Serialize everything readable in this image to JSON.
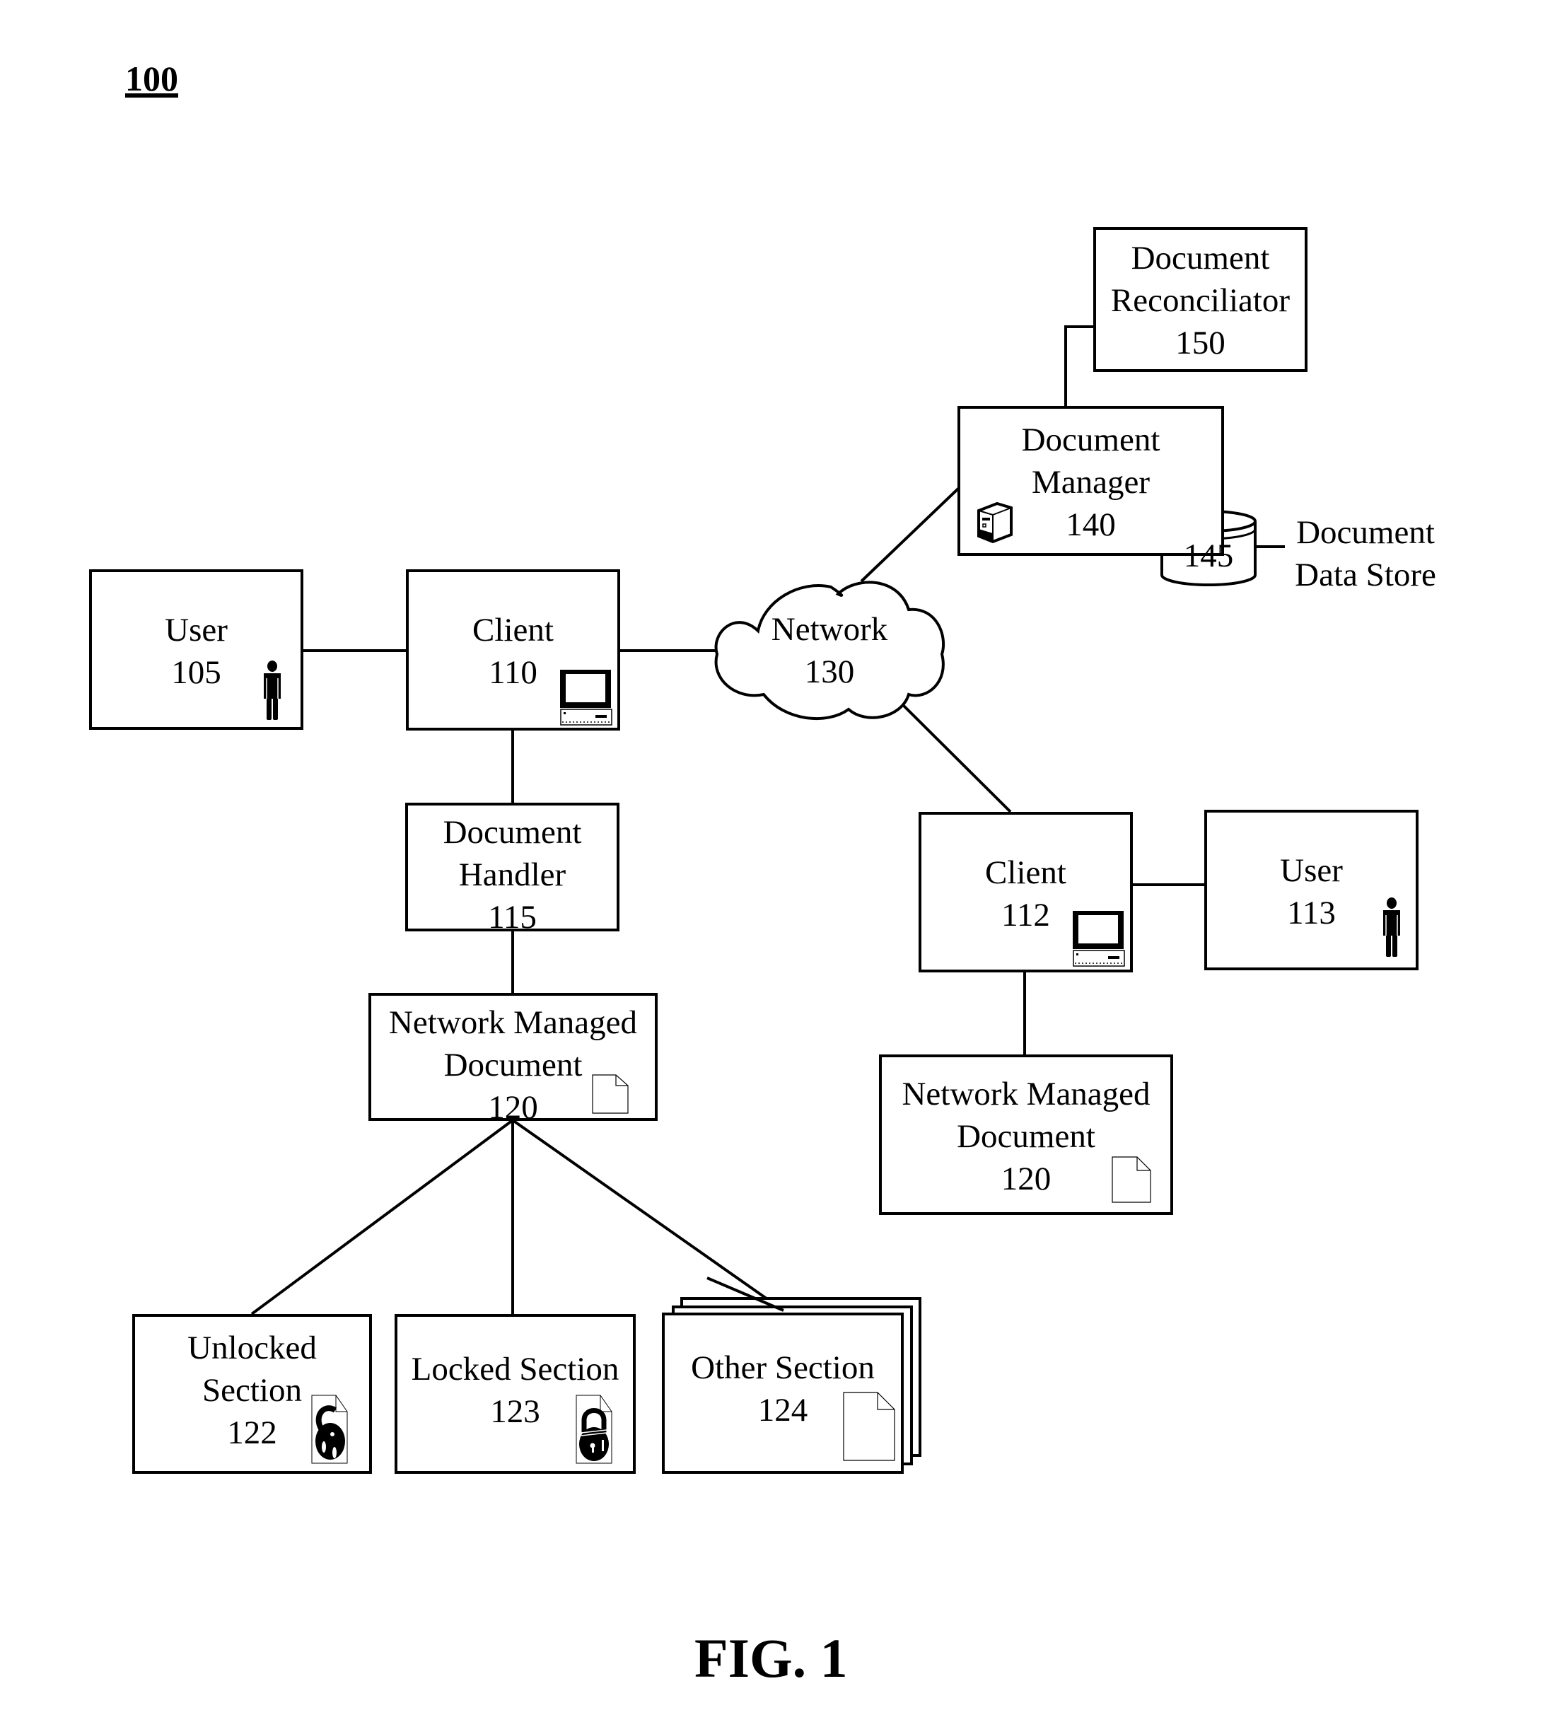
{
  "figure": {
    "reference": "100",
    "caption": "FIG. 1"
  },
  "nodes": {
    "user_105": {
      "lines": [
        "User",
        "105"
      ],
      "icon": "person-icon"
    },
    "client_110": {
      "lines": [
        "Client",
        "110"
      ],
      "icon": "computer-icon"
    },
    "network_130": {
      "lines": [
        "Network",
        "130"
      ],
      "shape": "cloud"
    },
    "document_manager_140": {
      "lines": [
        "Document",
        "Manager",
        "140"
      ],
      "icon": "server-icon"
    },
    "document_data_store_145": {
      "number": "145",
      "caption_lines": [
        "Document",
        "Data Store"
      ],
      "shape": "cylinder"
    },
    "document_reconciliator_150": {
      "lines": [
        "Document",
        "Reconciliator",
        "150"
      ]
    },
    "document_handler_115": {
      "lines": [
        "Document",
        "Handler",
        "115"
      ]
    },
    "network_managed_document_left": {
      "lines": [
        "Network Managed",
        "Document",
        "120"
      ],
      "icon": "document-icon"
    },
    "client_112": {
      "lines": [
        "Client",
        "112"
      ],
      "icon": "computer-icon"
    },
    "user_113": {
      "lines": [
        "User",
        "113"
      ],
      "icon": "person-icon"
    },
    "network_managed_document_right": {
      "lines": [
        "Network Managed",
        "Document",
        "120"
      ],
      "icon": "document-icon"
    },
    "unlocked_section_122": {
      "lines": [
        "Unlocked",
        "Section",
        "122"
      ],
      "icon": "unlocked-padlock-document-icon"
    },
    "locked_section_123": {
      "lines": [
        "Locked Section",
        "123"
      ],
      "icon": "locked-padlock-document-icon"
    },
    "other_section_124": {
      "lines": [
        "Other Section",
        "124"
      ],
      "icon": "document-icon",
      "stacked": true
    }
  },
  "connections": [
    [
      "user_105",
      "client_110"
    ],
    [
      "client_110",
      "network_130"
    ],
    [
      "client_110",
      "document_handler_115"
    ],
    [
      "document_handler_115",
      "network_managed_document_left"
    ],
    [
      "network_managed_document_left",
      "unlocked_section_122"
    ],
    [
      "network_managed_document_left",
      "locked_section_123"
    ],
    [
      "network_managed_document_left",
      "other_section_124"
    ],
    [
      "network_130",
      "document_manager_140"
    ],
    [
      "document_manager_140",
      "document_reconciliator_150"
    ],
    [
      "document_data_store_145",
      "document_data_store_label"
    ],
    [
      "network_130",
      "client_112"
    ],
    [
      "client_112",
      "user_113"
    ],
    [
      "client_112",
      "network_managed_document_right"
    ]
  ]
}
